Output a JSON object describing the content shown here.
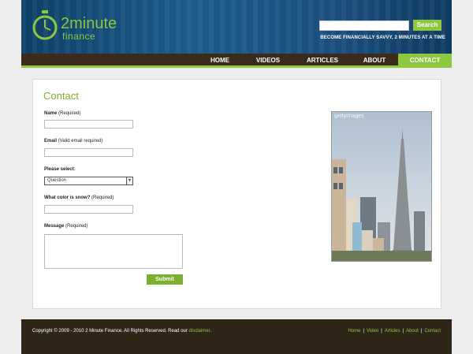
{
  "brand": {
    "name": "2minute",
    "sub": "finance"
  },
  "search": {
    "button_label": "Search",
    "placeholder": ""
  },
  "tagline": "BECOME FINANCIALLY SAVVY, 2 MINUTES AT A TIME",
  "nav": {
    "items": [
      "HOME",
      "VIDEOS",
      "ARTICLES",
      "ABOUT",
      "CONTACT"
    ],
    "active": "CONTACT"
  },
  "page_title": "Contact",
  "form": {
    "name_label": "Name",
    "name_note": "(Required)",
    "email_label": "Email",
    "email_note": "(Valid email required)",
    "select_label": "Please select:",
    "select_value": "Question",
    "snow_label": "What color is snow?",
    "snow_note": "(Required)",
    "message_label": "Message",
    "message_note": "(Required)",
    "submit_label": "Submit"
  },
  "photo_watermark": "gettyimages",
  "footer": {
    "copyright_prefix": "Copyright © 2009 - 2010 2 Minute Finance. All Rights Reserved. Read our ",
    "disclaimer_link": "disclaimer",
    "copyright_suffix": ".",
    "links": [
      "Home",
      "Video",
      "Articles",
      "About",
      "Contact"
    ]
  },
  "colors": {
    "accent": "#8dc63f",
    "header_blue": "#1b5a8c",
    "nav_brown": "#3b2b1a"
  },
  "icons": {
    "logo": "stopwatch-icon",
    "select_arrow": "dropdown-arrow-icon"
  }
}
